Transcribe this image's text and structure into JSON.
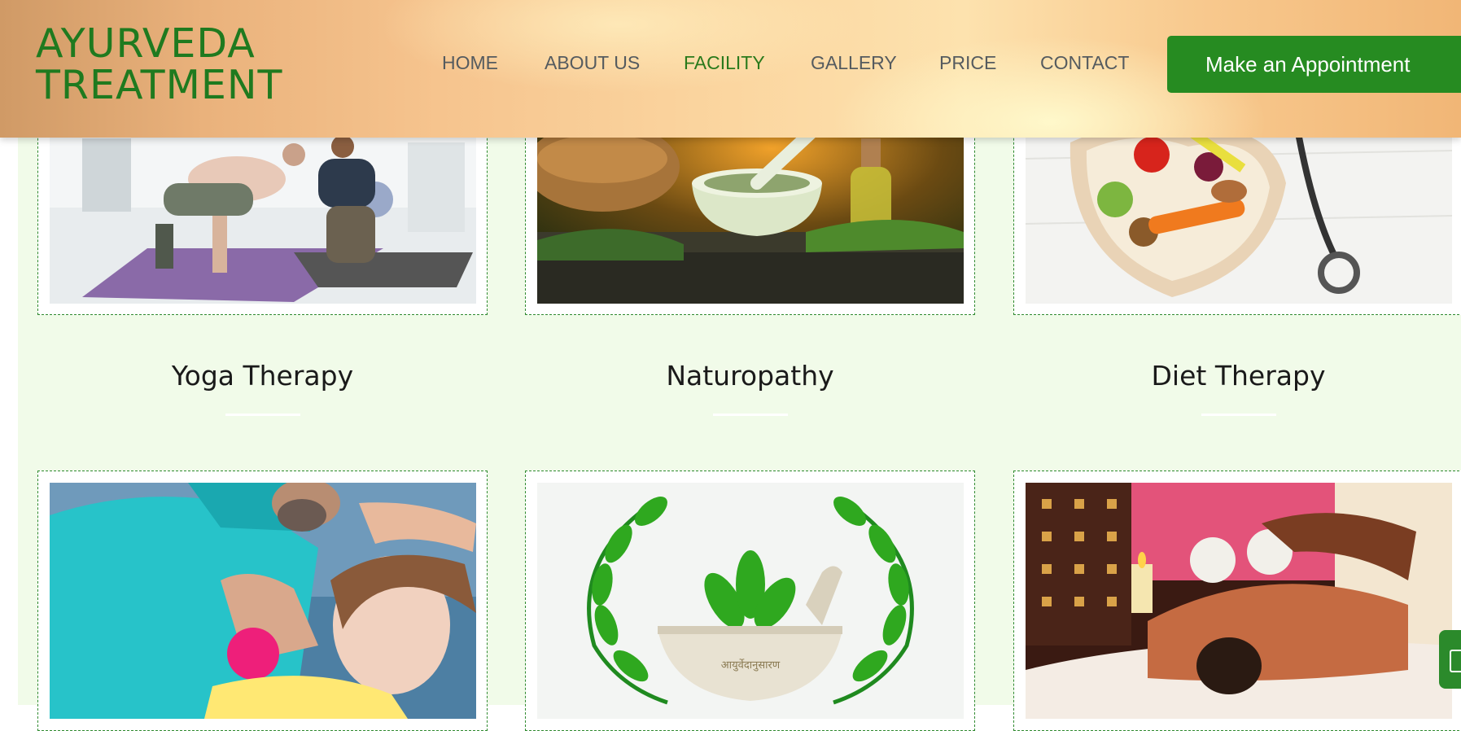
{
  "brand": {
    "line1": "AYURVEDA",
    "line2": "TREATMENT",
    "color": "#1f7a1f"
  },
  "nav": {
    "items": [
      {
        "label": "HOME",
        "active": false
      },
      {
        "label": "ABOUT US",
        "active": false
      },
      {
        "label": "FACILITY",
        "active": true
      },
      {
        "label": "GALLERY",
        "active": false
      },
      {
        "label": "PRICE",
        "active": false
      },
      {
        "label": "CONTACT",
        "active": false
      }
    ],
    "cta_label": "Make an Appointment",
    "cta_color": "#268b21"
  },
  "facilities": [
    {
      "title": "Yoga Therapy",
      "image": "yoga-photo"
    },
    {
      "title": "Naturopathy",
      "image": "herbal-mortar-photo"
    },
    {
      "title": "Diet Therapy",
      "image": "healthy-food-heart-photo"
    },
    {
      "image": "physiotherapy-photo"
    },
    {
      "image": "ayurveda-logo-mortar",
      "inscription": "आयुर्वेदानुसारण"
    },
    {
      "image": "herbal-massage-photo"
    }
  ],
  "theme": {
    "page_bg": "#f1fbe9",
    "card_border": "#2f8a2f"
  }
}
